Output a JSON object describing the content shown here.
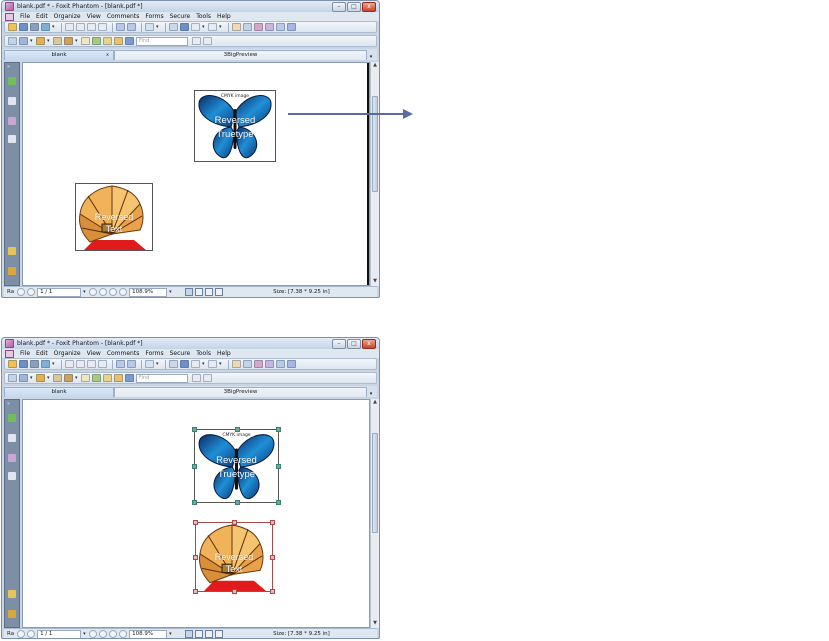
{
  "window": {
    "title_top": "blank.pdf * - Foxit Phantom - [blank.pdf *]",
    "title_bottom": "blank.pdf * - Foxit Phantom - [blank.pdf *]",
    "controls": {
      "minimize": "–",
      "maximize": "□",
      "close": "x"
    }
  },
  "menu": [
    "File",
    "Edit",
    "Organize",
    "View",
    "Comments",
    "Forms",
    "Secure",
    "Tools",
    "Help"
  ],
  "toolbar": {
    "find_placeholder": "Find",
    "dropdown_glyph": "▾"
  },
  "tabs": [
    {
      "label": "blank",
      "close": "x"
    },
    {
      "label": "3BigPreview"
    }
  ],
  "tab_scroll_glyph": "▾",
  "left_panel": {
    "collapse_glyph": "»"
  },
  "images": {
    "butterfly": {
      "caption": "CMYK image",
      "line1": "Reversed",
      "line2": "Truetype"
    },
    "fan": {
      "line1": "Reversed",
      "line2": "Text"
    }
  },
  "status": {
    "left_label": "Ra",
    "page": "1 / 1",
    "zoom": "108.9%",
    "size": "Size: [7.38 * 9.25 in]",
    "dropdown_glyph": "▾"
  },
  "scroll": {
    "up": "▲",
    "down": "▼"
  },
  "colors": {
    "chrome": "#c9d5e3",
    "arrow": "#5a6b9e",
    "selection_green": "#6aa99d",
    "selection_red": "#a84a4a"
  }
}
